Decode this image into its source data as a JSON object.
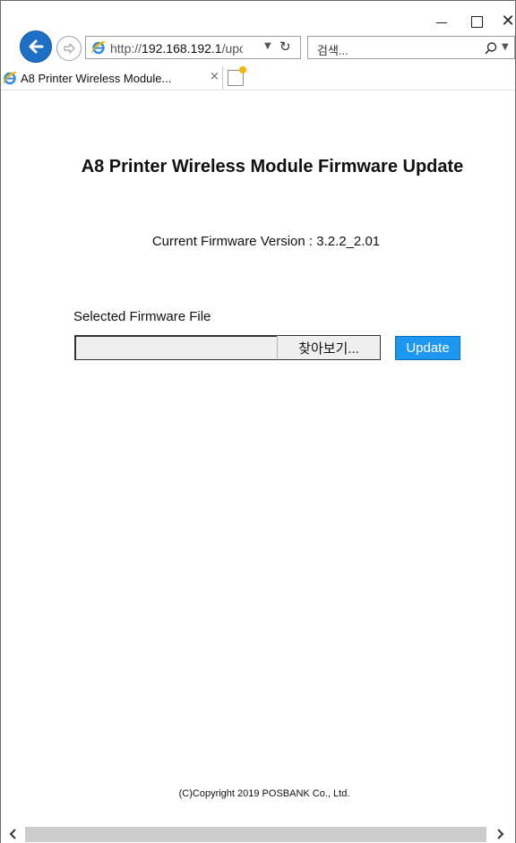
{
  "window": {
    "minimize_label": "minimize",
    "maximize_label": "maximize",
    "close_glyph": "✕"
  },
  "browser": {
    "url": "http://192.168.192.1/upc",
    "url_prefix": "http://",
    "url_host": "192.168.192.1",
    "url_rest": "/upc",
    "search_placeholder": "검색...",
    "tab_title": "A8 Printer Wireless Module...",
    "tab_close": "×",
    "accent_color": "#1e6fc6"
  },
  "page": {
    "title": "A8 Printer Wireless Module Firmware Update",
    "fw_version_text": "Current Firmware Version : 3.2.2_2.01",
    "file_label": "Selected Firmware File",
    "file_value": "",
    "browse_label": "찾아보기...",
    "update_label": "Update",
    "update_color": "#1e97f0",
    "copyright": "(C)Copyright 2019 POSBANK Co., Ltd."
  },
  "icons": {
    "back": "back-arrow-icon",
    "forward": "forward-arrow-icon",
    "ie": "ie-logo-icon",
    "refresh": "refresh-icon",
    "search": "search-icon",
    "new_tab": "new-tab-icon"
  }
}
